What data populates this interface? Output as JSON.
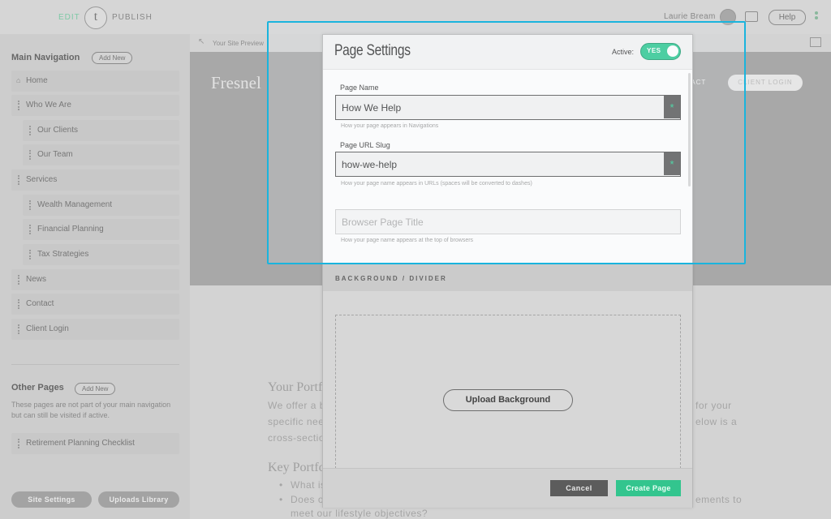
{
  "topbar": {
    "edit": "EDIT",
    "logo": "t",
    "publish": "PUBLISH",
    "user": "Laurie Bream",
    "help": "Help"
  },
  "sidebar": {
    "main_title": "Main Navigation",
    "add_new": "Add New",
    "items": [
      {
        "label": "Home"
      },
      {
        "label": "Who We Are"
      },
      {
        "label": "Our Clients"
      },
      {
        "label": "Our Team"
      },
      {
        "label": "Services"
      },
      {
        "label": "Wealth Management"
      },
      {
        "label": "Financial Planning"
      },
      {
        "label": "Tax Strategies"
      },
      {
        "label": "News"
      },
      {
        "label": "Contact"
      },
      {
        "label": "Client Login"
      }
    ],
    "other_title": "Other Pages",
    "other_add_new": "Add New",
    "other_desc": "These pages are not part of your main navigation but can still be visited if active.",
    "other_items": [
      {
        "label": "Retirement Planning Checklist"
      }
    ],
    "site_settings": "Site Settings",
    "uploads_library": "Uploads Library"
  },
  "preview": {
    "label": "Your Site Preview",
    "brand": "Fresnel",
    "contact": "TACT",
    "client_login": "CLIENT LOGIN",
    "heading1": "Your Portf",
    "para_lines": [
      "We offer a b",
      "specific nee",
      "cross-sectio"
    ],
    "para_right": [
      "for your",
      "elow is a"
    ],
    "heading2": "Key Portfo",
    "bullets": [
      "What is",
      "Does o"
    ],
    "bullet_right": "ements to",
    "last_line": "meet our lifestyle objectives?"
  },
  "modal": {
    "title": "Page Settings",
    "active_label": "Active:",
    "toggle_value": "YES",
    "fields": {
      "page_name": {
        "label": "Page Name",
        "value": "How We Help",
        "required": "*",
        "help": "How your page appears in Navigations"
      },
      "url_slug": {
        "label": "Page URL Slug",
        "value": "how-we-help",
        "required": "*",
        "help": "How your page name appears in URLs (spaces will be converted to dashes)"
      },
      "browser_title": {
        "placeholder": "Browser Page Title",
        "help": "How your page name appears at the top of browsers"
      }
    },
    "background_section": "BACKGROUND / DIVIDER",
    "upload_button": "Upload Background",
    "cancel": "Cancel",
    "create": "Create Page"
  }
}
